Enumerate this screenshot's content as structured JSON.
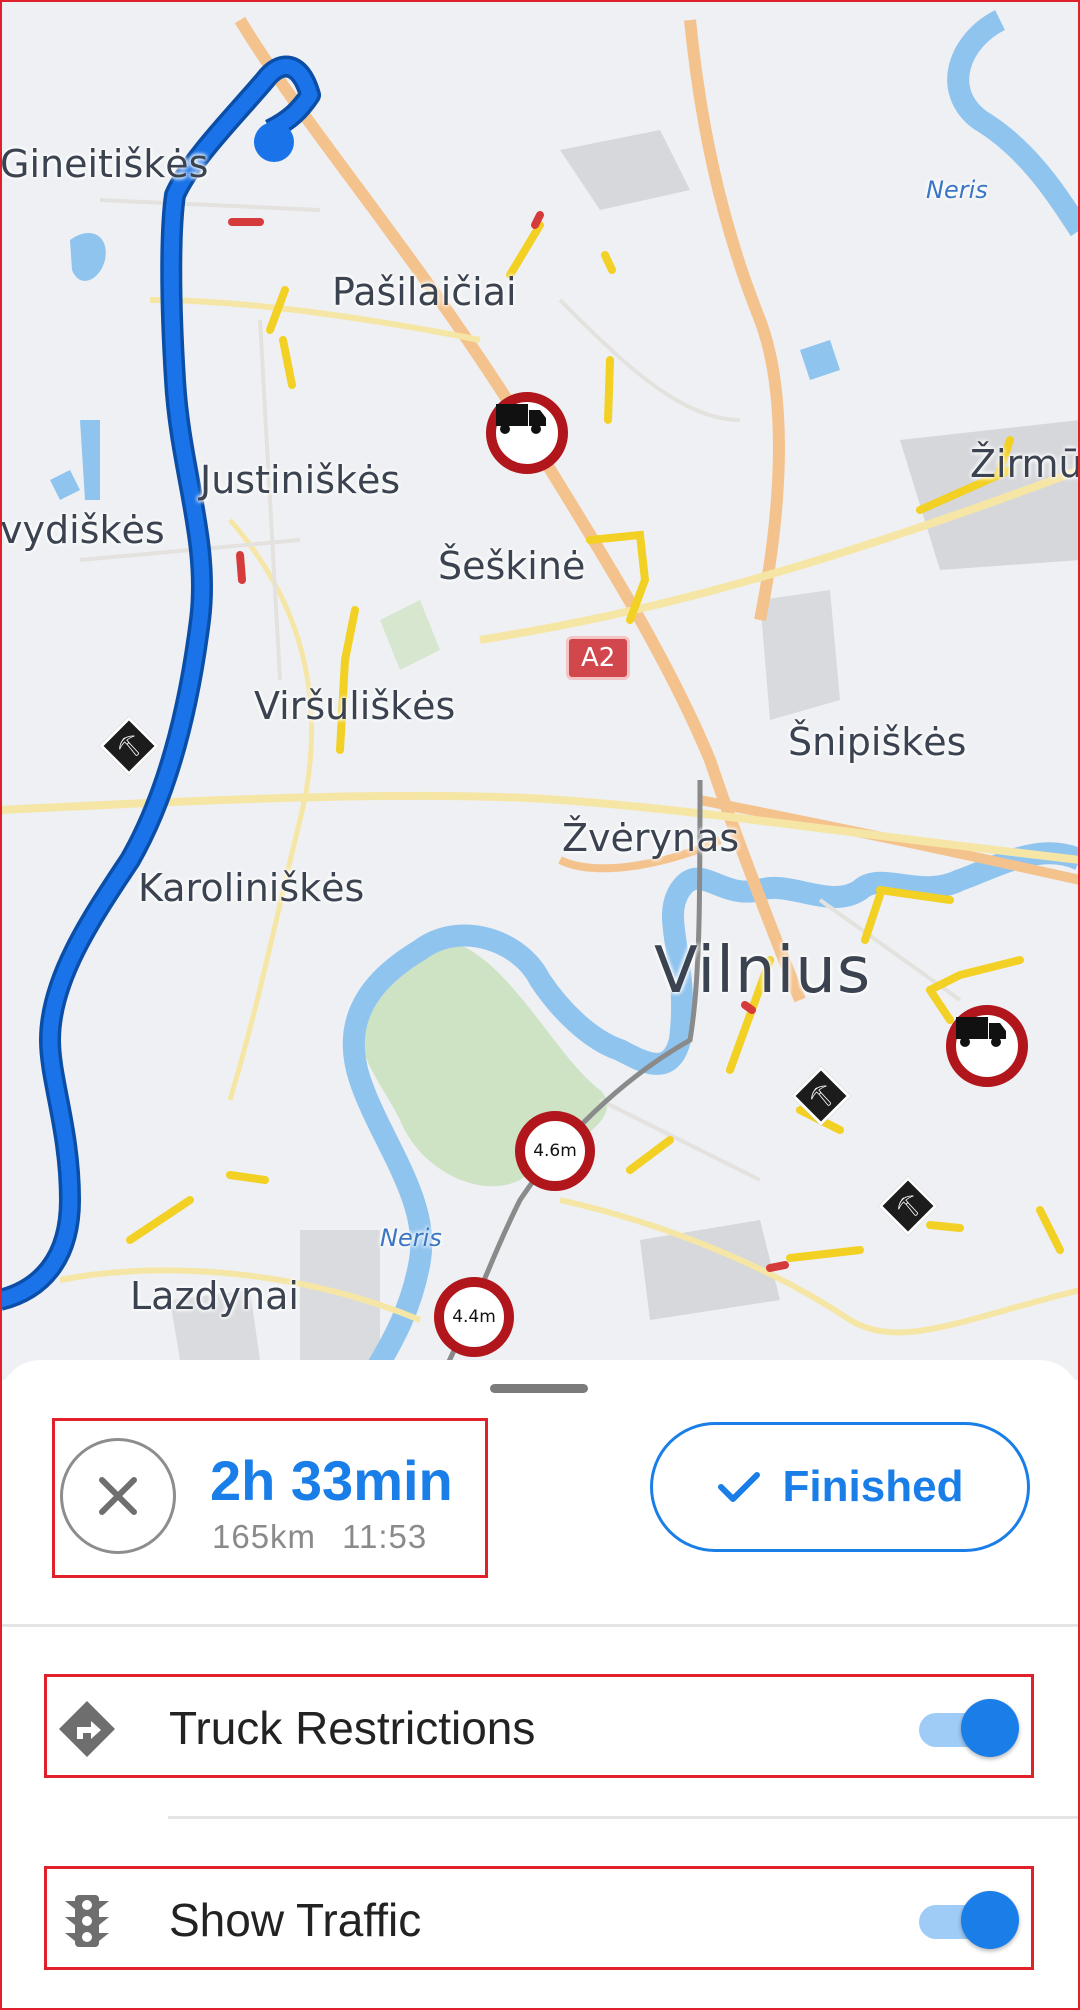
{
  "map": {
    "labels": {
      "gineitiskes": "Gineitiškės",
      "pasilaiciai": "Pašilaičiai",
      "justiniskes": "Justiniškės",
      "vydiskes": "vydiškės",
      "seskine": "Šeškinė",
      "virsuliskes": "Viršuliškės",
      "snipiskes": "Šnipiškės",
      "zverynas": "Žvėrynas",
      "karoliniskes": "Karoliniškės",
      "vilnius": "Vilnius",
      "lazdynai": "Lazdynai",
      "zirmunai": "Žirmū",
      "neris_top": "Neris",
      "neris_bottom": "Neris"
    },
    "road_shield": "A2",
    "height_limits": [
      "4.6m",
      "4.4m"
    ],
    "colors": {
      "route": "#1a73e8",
      "river": "#8fc4ef",
      "park": "#cde3c4",
      "traffic": "#f2d024",
      "restriction": "#b0161b"
    }
  },
  "sheet": {
    "route": {
      "duration": "2h 33min",
      "distance": "165km",
      "arrival": "11:53"
    },
    "finished_label": "Finished",
    "options": [
      {
        "label": "Truck Restrictions",
        "icon": "direction-sign-icon",
        "enabled": true
      },
      {
        "label": "Show Traffic",
        "icon": "traffic-light-icon",
        "enabled": true
      }
    ]
  },
  "colors": {
    "accent": "#1a7ee8",
    "highlight_box": "#e0202a"
  }
}
